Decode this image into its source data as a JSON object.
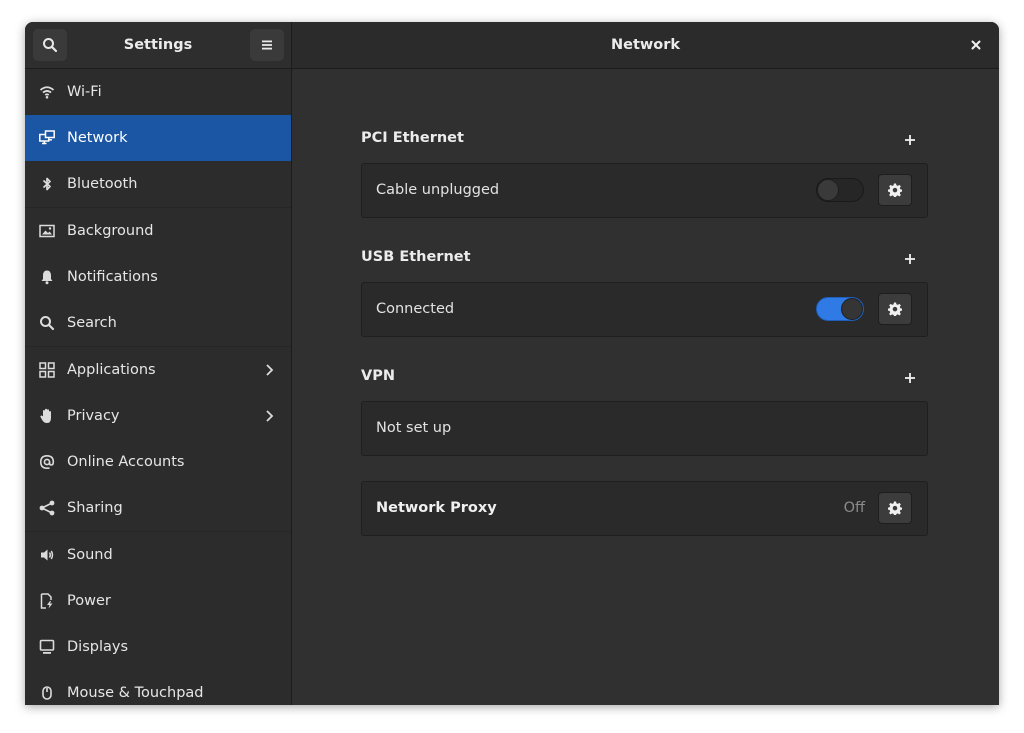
{
  "header": {
    "sidebar_title": "Settings",
    "page_title": "Network"
  },
  "sidebar": {
    "items": [
      {
        "label": "Wi-Fi",
        "icon": "wifi-icon"
      },
      {
        "label": "Network",
        "icon": "network-icon",
        "active": true
      },
      {
        "label": "Bluetooth",
        "icon": "bluetooth-icon"
      },
      {
        "label": "Background",
        "icon": "background-icon"
      },
      {
        "label": "Notifications",
        "icon": "bell-icon"
      },
      {
        "label": "Search",
        "icon": "search-icon"
      },
      {
        "label": "Applications",
        "icon": "grid-icon",
        "has_submenu": true
      },
      {
        "label": "Privacy",
        "icon": "hand-icon",
        "has_submenu": true
      },
      {
        "label": "Online Accounts",
        "icon": "at-icon"
      },
      {
        "label": "Sharing",
        "icon": "share-icon"
      },
      {
        "label": "Sound",
        "icon": "speaker-icon"
      },
      {
        "label": "Power",
        "icon": "power-icon"
      },
      {
        "label": "Displays",
        "icon": "display-icon"
      },
      {
        "label": "Mouse & Touchpad",
        "icon": "mouse-icon"
      }
    ]
  },
  "content": {
    "pci": {
      "title": "PCI Ethernet",
      "status": "Cable unplugged",
      "enabled": false
    },
    "usb": {
      "title": "USB Ethernet",
      "status": "Connected",
      "enabled": true
    },
    "vpn": {
      "title": "VPN",
      "status": "Not set up"
    },
    "proxy": {
      "label": "Network Proxy",
      "status": "Off"
    }
  },
  "colors": {
    "accent": "#1b56a4",
    "toggle_on": "#2f7ae5"
  }
}
